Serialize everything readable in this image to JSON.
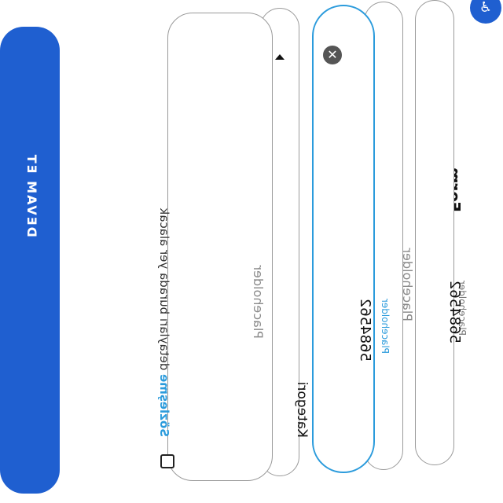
{
  "form": {
    "title": "Form",
    "badge_icon": "accessibility-icon",
    "fields": [
      {
        "label": "Placeholder",
        "value": "5684562",
        "state": "filled"
      },
      {
        "label": "Placeholder",
        "value": "",
        "state": "empty"
      },
      {
        "label": "Placeholder",
        "value": "5684562",
        "state": "focused"
      },
      {
        "label": "Kategori",
        "value": "",
        "state": "dropdown"
      },
      {
        "label": "Placeholder",
        "value": "",
        "state": "textarea"
      }
    ],
    "terms": {
      "link_text": "Sözleşme",
      "rest_text": " detayları burada yer alacak"
    },
    "submit_label": "DEVAM ET",
    "accent_color": "#2b9bdc",
    "button_color": "#1f5fd0"
  }
}
